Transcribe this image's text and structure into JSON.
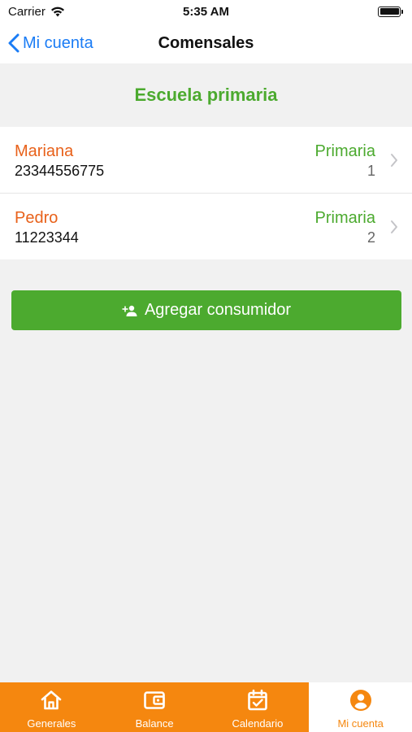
{
  "status_bar": {
    "carrier": "Carrier",
    "time": "5:35 AM"
  },
  "nav": {
    "back_label": "Mi cuenta",
    "title": "Comensales"
  },
  "section": {
    "title": "Escuela primaria"
  },
  "consumers": [
    {
      "name": "Mariana",
      "id": "23344556775",
      "level": "Primaria",
      "grade": "1"
    },
    {
      "name": "Pedro",
      "id": "11223344",
      "level": "Primaria",
      "grade": "2"
    }
  ],
  "add_button": {
    "label": "Agregar consumidor",
    "icon": "add-person-icon"
  },
  "tabs": [
    {
      "label": "Generales",
      "icon": "home-icon",
      "active": false
    },
    {
      "label": "Balance",
      "icon": "wallet-icon",
      "active": false
    },
    {
      "label": "Calendario",
      "icon": "calendar-check-icon",
      "active": false
    },
    {
      "label": "Mi cuenta",
      "icon": "account-circle-icon",
      "active": true
    }
  ],
  "colors": {
    "accent_orange": "#f5870f",
    "name_orange": "#e8611a",
    "green": "#4caa2f",
    "link_blue": "#1a7cf5",
    "background": "#f1f1f1"
  }
}
